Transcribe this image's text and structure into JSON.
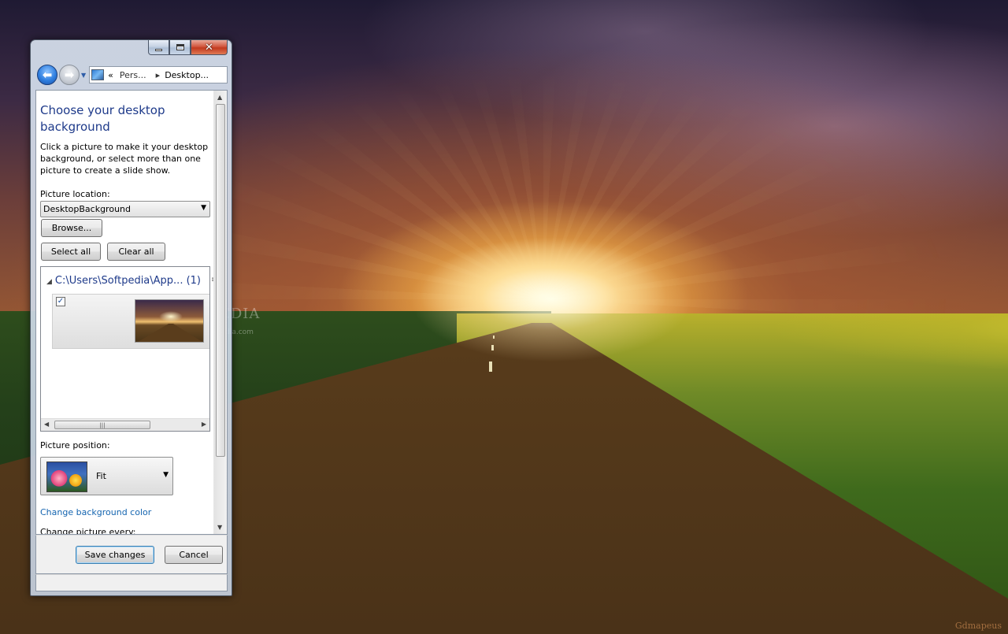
{
  "window": {
    "minimize_glyph": "minimize-icon",
    "maximize_glyph": "maximize-icon",
    "close_label": "✕"
  },
  "nav": {
    "back_label": "⬅",
    "forward_label": "➡",
    "address": {
      "overflow": "«",
      "crumb1": "Pers...",
      "separator": "▸",
      "crumb2": "Desktop..."
    }
  },
  "page": {
    "title": "Choose your desktop background",
    "description": "Click a picture to make it your desktop background, or select more than one picture to create a slide show.",
    "picture_location_label": "Picture location:",
    "picture_location_value": "DesktopBackground",
    "browse_label": "Browse...",
    "select_all_label": "Select all",
    "clear_all_label": "Clear all",
    "group_header": "C:\\Users\\Softpedia\\App... (1)",
    "thumbnail_checked": true,
    "check_mark": "✓",
    "picture_position_label": "Picture position:",
    "picture_position_value": "Fit",
    "change_color_link": "Change background color",
    "change_every_label": "Change picture every:"
  },
  "footer": {
    "save_label": "Save changes",
    "cancel_label": "Cancel"
  },
  "desktop": {
    "watermark": "SOFTPEDIA",
    "watermark_url": "www.softpedia.com",
    "signature": "Gdmapeus"
  },
  "colors": {
    "title_blue": "#1e3a8a",
    "link_blue": "#1565b0",
    "close_red": "#c23a1f"
  }
}
